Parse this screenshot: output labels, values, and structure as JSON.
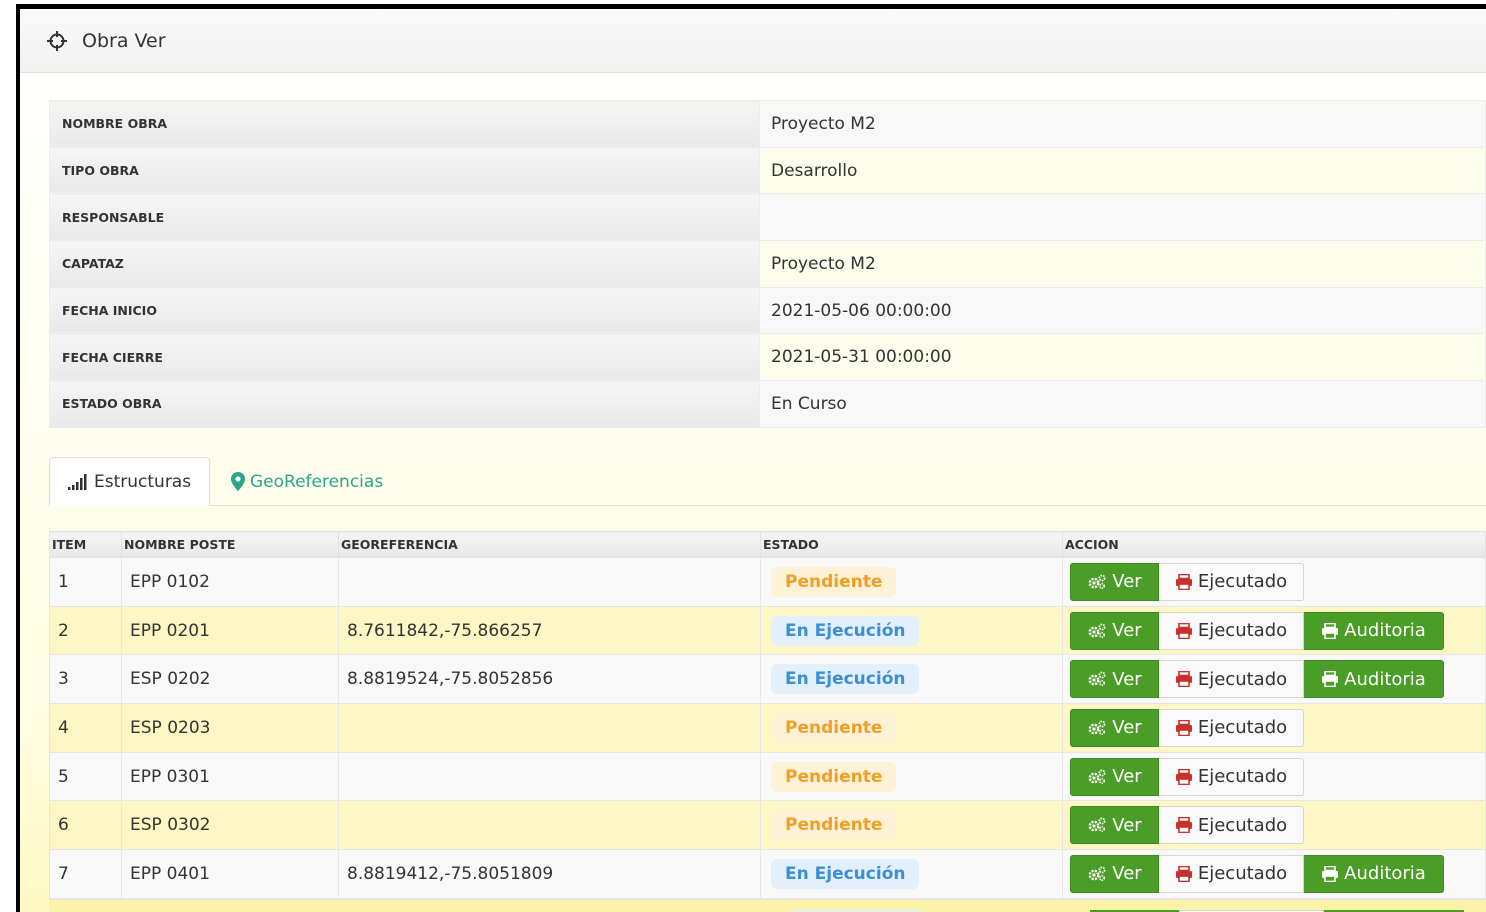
{
  "header": {
    "title": "Obra Ver",
    "icon": "crosshairs-icon"
  },
  "details": [
    {
      "label": "NOMBRE OBRA",
      "value": "Proyecto M2"
    },
    {
      "label": "TIPO OBRA",
      "value": "Desarrollo"
    },
    {
      "label": "RESPONSABLE",
      "value": ""
    },
    {
      "label": "CAPATAZ",
      "value": "Proyecto M2"
    },
    {
      "label": "FECHA INICIO",
      "value": "2021-05-06 00:00:00"
    },
    {
      "label": "FECHA CIERRE",
      "value": "2021-05-31 00:00:00"
    },
    {
      "label": "ESTADO OBRA",
      "value": "En Curso"
    }
  ],
  "tabs": [
    {
      "label": "Estructuras",
      "icon": "signal-bars-icon",
      "active": true
    },
    {
      "label": "GeoReferencias",
      "icon": "map-marker-icon",
      "active": false
    }
  ],
  "table": {
    "headers": [
      "ITEM",
      "NOMBRE POSTE",
      "GEOREFERENCIA",
      "ESTADO",
      "ACCION"
    ],
    "rows": [
      {
        "item": "1",
        "nombre": "EPP 0102",
        "geo": "",
        "estado": "Pendiente"
      },
      {
        "item": "2",
        "nombre": "EPP 0201",
        "geo": "8.7611842,-75.866257",
        "estado": "En Ejecución"
      },
      {
        "item": "3",
        "nombre": "ESP 0202",
        "geo": "8.8819524,-75.8052856",
        "estado": "En Ejecución"
      },
      {
        "item": "4",
        "nombre": "ESP 0203",
        "geo": "",
        "estado": "Pendiente"
      },
      {
        "item": "5",
        "nombre": "EPP 0301",
        "geo": "",
        "estado": "Pendiente"
      },
      {
        "item": "6",
        "nombre": "ESP 0302",
        "geo": "",
        "estado": "Pendiente"
      },
      {
        "item": "7",
        "nombre": "EPP 0401",
        "geo": "8.8819412,-75.8051809",
        "estado": "En Ejecución"
      }
    ]
  },
  "actions": {
    "ver": "Ver",
    "ejecutado": "Ejecutado",
    "auditoria": "Auditoria"
  },
  "colors": {
    "green": "#4a9e27",
    "pendiente": "#f0a028",
    "ejecucion": "#3a8fd6",
    "geo_tab": "#2aa58c"
  }
}
